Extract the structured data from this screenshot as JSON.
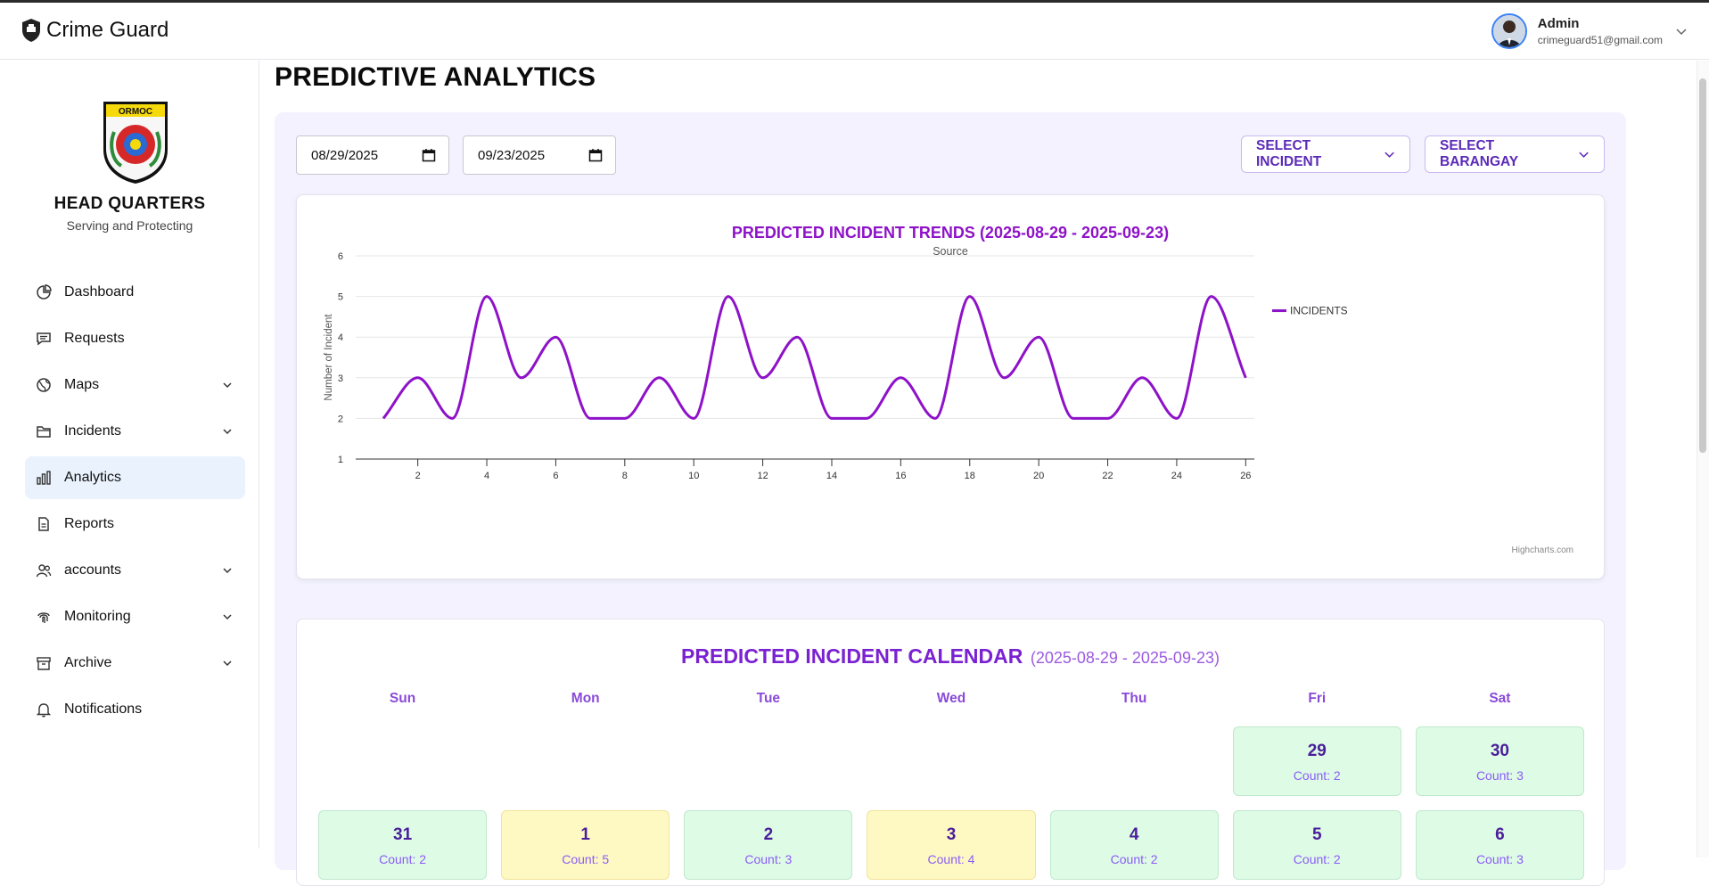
{
  "app": {
    "name": "Crime Guard"
  },
  "user": {
    "name": "Admin",
    "email": "crimeguard51@gmail.com"
  },
  "sidebar": {
    "title": "HEAD QUARTERS",
    "subtitle": "Serving and Protecting",
    "seal_text": "ORMOC",
    "items": [
      {
        "label": "Dashboard",
        "icon": "pie-chart-icon",
        "expandable": false,
        "active": false
      },
      {
        "label": "Requests",
        "icon": "message-icon",
        "expandable": false,
        "active": false
      },
      {
        "label": "Maps",
        "icon": "globe-icon",
        "expandable": true,
        "active": false
      },
      {
        "label": "Incidents",
        "icon": "folder-icon",
        "expandable": true,
        "active": false
      },
      {
        "label": "Analytics",
        "icon": "bar-chart-icon",
        "expandable": false,
        "active": true
      },
      {
        "label": "Reports",
        "icon": "document-icon",
        "expandable": false,
        "active": false
      },
      {
        "label": "accounts",
        "icon": "users-icon",
        "expandable": true,
        "active": false
      },
      {
        "label": "Monitoring",
        "icon": "fingerprint-icon",
        "expandable": true,
        "active": false
      },
      {
        "label": "Archive",
        "icon": "archive-icon",
        "expandable": true,
        "active": false
      },
      {
        "label": "Notifications",
        "icon": "bell-icon",
        "expandable": false,
        "active": false
      }
    ]
  },
  "main": {
    "title": "PREDICTIVE ANALYTICS",
    "filters": {
      "start_date": "08/29/2025",
      "end_date": "09/23/2025",
      "incident_label": "SELECT INCIDENT",
      "barangay_label": "SELECT BARANGAY"
    }
  },
  "chart_data": {
    "type": "line",
    "title": "PREDICTED INCIDENT TRENDS (2025-08-29 - 2025-09-23)",
    "subtitle": "Source",
    "ylabel": "Number of Incident",
    "xlabel": "",
    "credits": "Highcharts.com",
    "x": [
      1,
      2,
      3,
      4,
      5,
      6,
      7,
      8,
      9,
      10,
      11,
      12,
      13,
      14,
      15,
      16,
      17,
      18,
      19,
      20,
      21,
      22,
      23,
      24,
      25,
      26
    ],
    "xticks": [
      2,
      4,
      6,
      8,
      10,
      12,
      14,
      16,
      18,
      20,
      22,
      24,
      26
    ],
    "yticks": [
      1,
      2,
      3,
      4,
      5,
      6
    ],
    "xlim": [
      0.2,
      26.25
    ],
    "ylim": [
      1,
      6
    ],
    "series": [
      {
        "name": "INCIDENTS",
        "color": "#8e12c8",
        "values": [
          2,
          3,
          2,
          5,
          3,
          4,
          2,
          2,
          3,
          2,
          5,
          3,
          4,
          2,
          2,
          3,
          2,
          5,
          3,
          4,
          2,
          2,
          3,
          2,
          5,
          3
        ]
      }
    ],
    "legend_position": "right",
    "grid": true
  },
  "calendar": {
    "title": "PREDICTED INCIDENT CALENDAR",
    "range": "(2025-08-29 - 2025-09-23)",
    "weekdays": [
      "Sun",
      "Mon",
      "Tue",
      "Wed",
      "Thu",
      "Fri",
      "Sat"
    ],
    "count_prefix": "Count: ",
    "days": [
      {
        "day": "",
        "count": null
      },
      {
        "day": "",
        "count": null
      },
      {
        "day": "",
        "count": null
      },
      {
        "day": "",
        "count": null
      },
      {
        "day": "",
        "count": null
      },
      {
        "day": "29",
        "count": 2
      },
      {
        "day": "30",
        "count": 3
      },
      {
        "day": "31",
        "count": 2
      },
      {
        "day": "1",
        "count": 5
      },
      {
        "day": "2",
        "count": 3
      },
      {
        "day": "3",
        "count": 4
      },
      {
        "day": "4",
        "count": 2
      },
      {
        "day": "5",
        "count": 2
      },
      {
        "day": "6",
        "count": 3
      }
    ]
  }
}
